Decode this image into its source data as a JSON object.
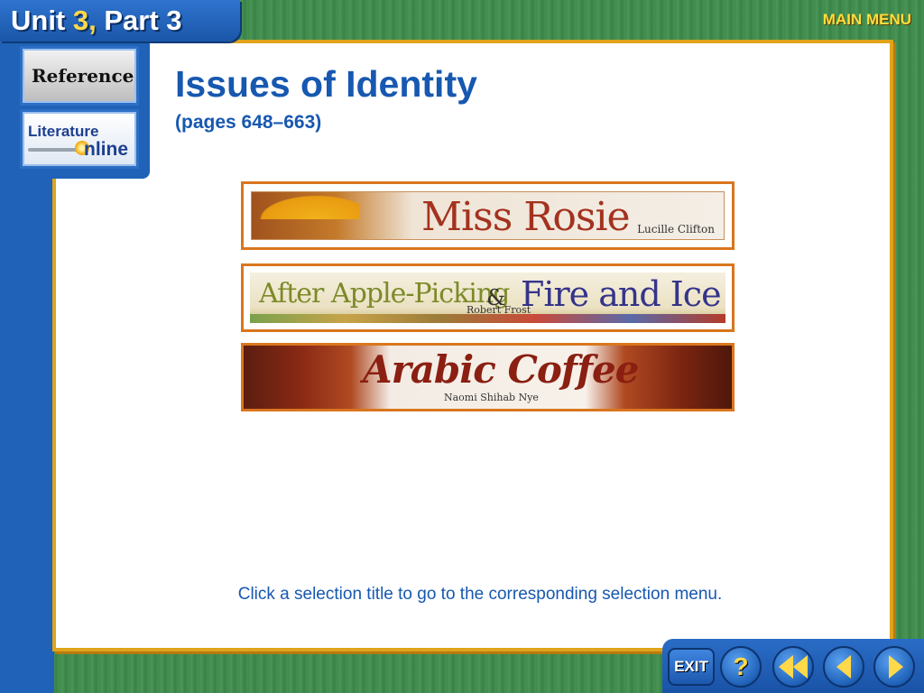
{
  "header": {
    "unit_label": "Unit",
    "unit_number": "3,",
    "part_label": "Part 3",
    "main_menu": "MAIN MENU"
  },
  "sidebar": {
    "reference": "Reference",
    "literature_line1": "Literature",
    "literature_line2": "nline"
  },
  "content": {
    "title": "Issues of Identity",
    "pages": "(pages 648–663)",
    "selections": [
      {
        "title": "Miss Rosie",
        "author": "Lucille Clifton"
      },
      {
        "title_part1": "After Apple-Picking",
        "amp": "&",
        "title_part2": "Fire and Ice",
        "author": "Robert Frost"
      },
      {
        "title": "Arabic Coffee",
        "author": "Naomi Shihab Nye"
      }
    ],
    "instruction": "Click a selection title to go to the corresponding selection menu."
  },
  "nav": {
    "exit": "EXIT",
    "help": "?",
    "icons": [
      "exit-button",
      "help-icon",
      "back-to-start-icon",
      "previous-arrow-icon",
      "next-arrow-icon"
    ]
  },
  "colors": {
    "blue": "#1f62b8",
    "title_blue": "#1758b0",
    "border_orange": "#e0a31a",
    "yellow": "#ffd94a"
  }
}
